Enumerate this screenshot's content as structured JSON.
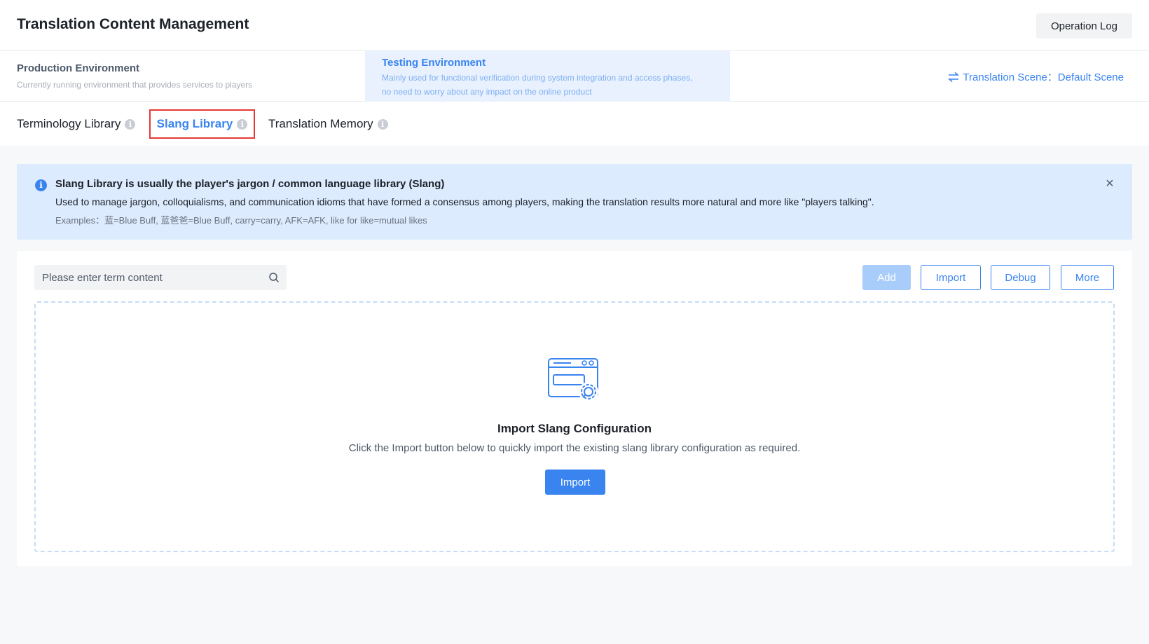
{
  "header": {
    "title": "Translation Content Management",
    "operation_log_label": "Operation Log"
  },
  "environments": {
    "production": {
      "title": "Production Environment",
      "description": "Currently running environment that provides services to players"
    },
    "testing": {
      "title": "Testing Environment",
      "description": "Mainly used for functional verification during system integration and access phases, no need to worry about any impact on the online product"
    },
    "scene_label": "Translation Scene：Default Scene",
    "scene_icon": "swap-arrows-icon"
  },
  "tabs": [
    {
      "label": "Terminology Library",
      "active": false
    },
    {
      "label": "Slang Library",
      "active": true
    },
    {
      "label": "Translation Memory",
      "active": false
    }
  ],
  "alert": {
    "title": "Slang Library is usually the player's jargon / common language library (Slang)",
    "body": "Used to manage jargon, colloquialisms, and communication idioms that have formed a consensus among players, making the translation results more natural and more like \"players talking\".",
    "examples": "Examples：蓝=Blue Buff, 蓝爸爸=Blue Buff, carry=carry, AFK=AFK, like for like=mutual likes"
  },
  "toolbar": {
    "search_placeholder": "Please enter term content",
    "add_label": "Add",
    "import_label": "Import",
    "debug_label": "Debug",
    "more_label": "More"
  },
  "empty_state": {
    "title": "Import Slang Configuration",
    "description": "Click the Import button below to quickly import the existing slang library configuration as required.",
    "import_label": "Import",
    "icon": "config-window-gear-icon"
  },
  "colors": {
    "accent": "#3a84f0",
    "alert_bg": "#dcebfd",
    "highlight_border": "#e53935"
  }
}
